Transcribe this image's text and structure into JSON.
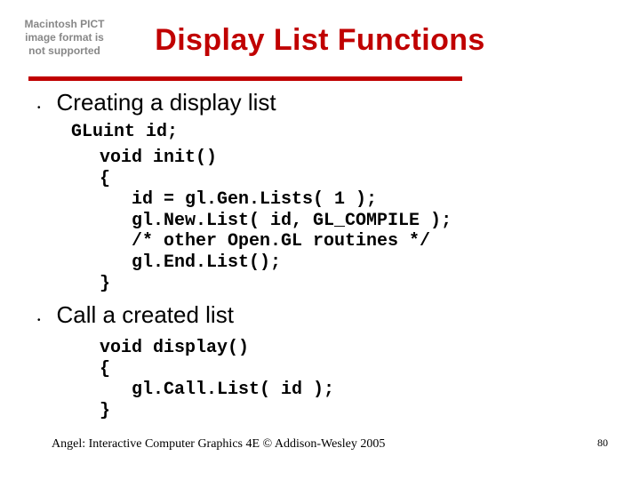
{
  "pict_placeholder": "Macintosh PICT\nimage format\nis not supported",
  "title": "Display List Functions",
  "bullets": [
    {
      "text": "Creating a display list",
      "code_line": "GLuint id;",
      "code_block": "void init()\n{\n   id = gl.Gen.Lists( 1 );\n   gl.New.List( id, GL_COMPILE );\n   /* other Open.GL routines */\n   gl.End.List();\n}"
    },
    {
      "text": "Call a created list",
      "code_line": "",
      "code_block": "void display()\n{\n   gl.Call.List( id );\n}"
    }
  ],
  "footer": "Angel: Interactive Computer Graphics 4E © Addison-Wesley 2005",
  "page_number": "80"
}
